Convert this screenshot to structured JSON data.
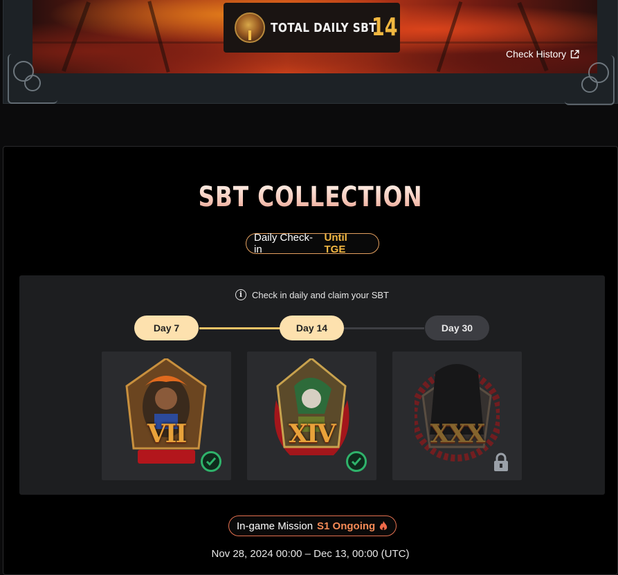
{
  "header": {
    "total_label": "TOTAL DAILY SBT",
    "total_count": "14",
    "check_history": "Check History"
  },
  "collection": {
    "title": "SBT COLLECTION",
    "checkin": {
      "label": "Daily Check-in",
      "highlight": "Until TGE"
    },
    "info": "Check in daily and claim your SBT",
    "progress_fraction": 0.5,
    "days": [
      {
        "label": "Day 7",
        "status": "claimed",
        "numeral": "VII"
      },
      {
        "label": "Day 14",
        "status": "claimed",
        "numeral": "XIV"
      },
      {
        "label": "Day 30",
        "status": "locked",
        "numeral": "XXX"
      }
    ],
    "mission": {
      "label": "In-game Mission",
      "highlight": "S1 Ongoing"
    },
    "date_range": "Nov 28, 2024 00:00 – Dec 13, 00:00 (UTC)"
  },
  "colors": {
    "accent_gold": "#f3b742",
    "day_done": "#fde1ae",
    "day_locked": "#3c3d42",
    "check_green": "#2fb36b",
    "mission_orange": "#f58a56"
  },
  "icons": [
    "medal-icon",
    "external-link-icon",
    "info-icon",
    "check-circle-icon",
    "lock-icon",
    "flame-icon"
  ]
}
